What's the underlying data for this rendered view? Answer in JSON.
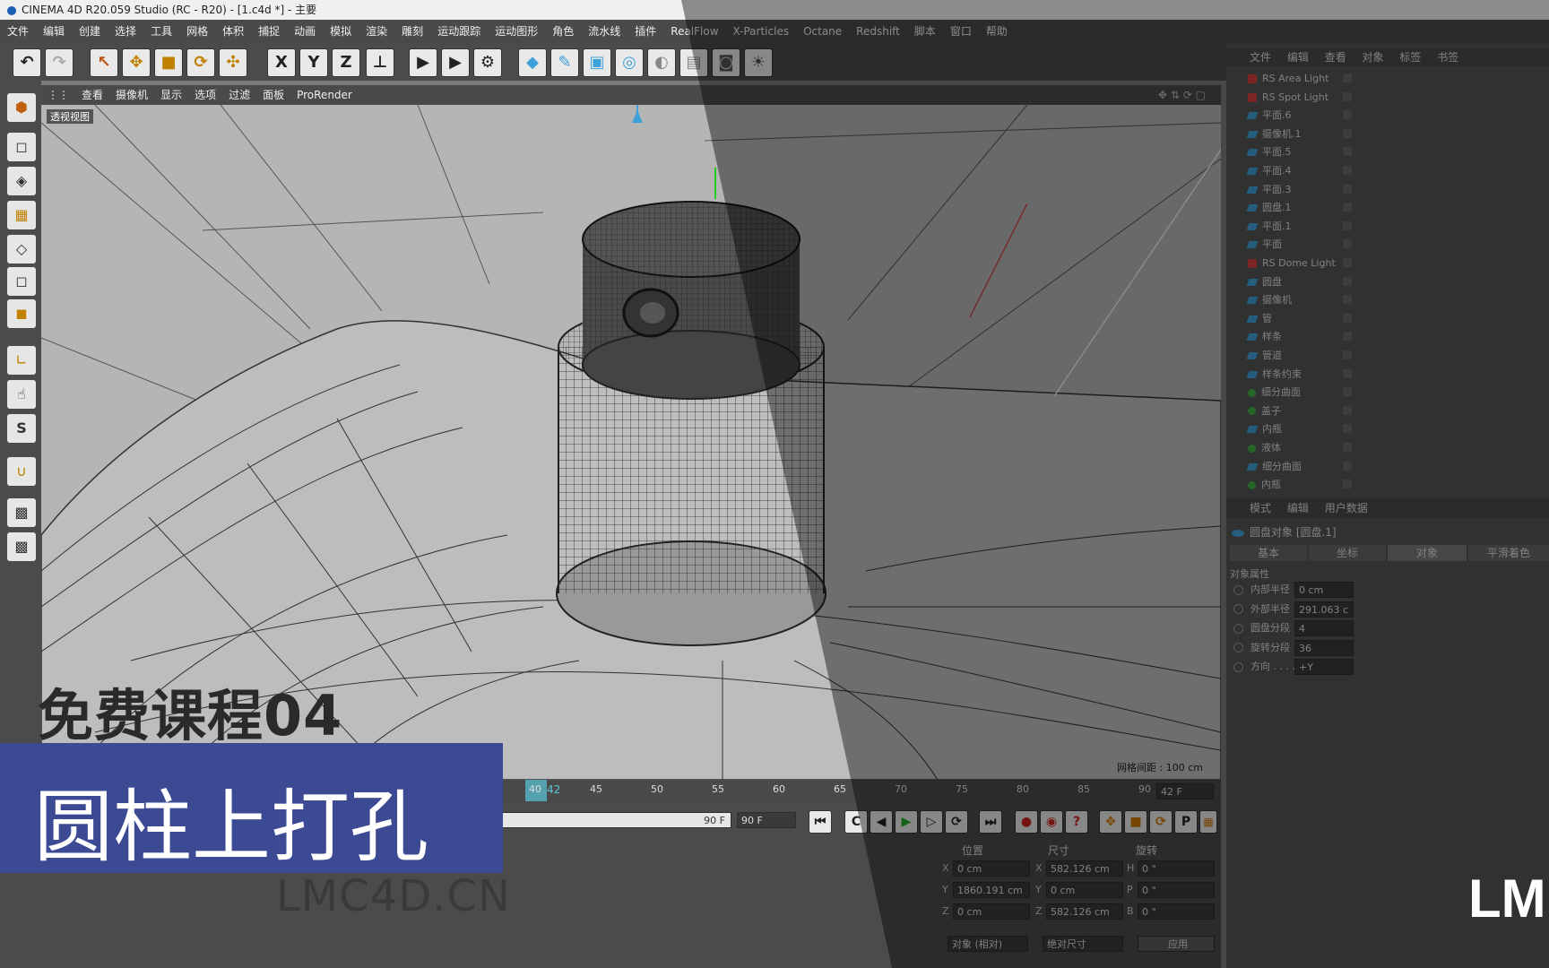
{
  "window": {
    "title": "CINEMA 4D R20.059 Studio (RC - R20) - [1.c4d *] - 主要"
  },
  "menu": [
    "文件",
    "编辑",
    "创建",
    "选择",
    "工具",
    "网格",
    "体积",
    "捕捉",
    "动画",
    "模拟",
    "渲染",
    "雕刻",
    "运动跟踪",
    "运动图形",
    "角色",
    "流水线",
    "插件",
    "RealFlow",
    "X-Particles",
    "Octane",
    "Redshift",
    "脚本",
    "窗口",
    "帮助"
  ],
  "toolbar_icons": [
    "undo-icon",
    "redo-icon",
    "select-arrow-icon",
    "move-icon",
    "scale-icon",
    "rotate-icon",
    "transform-icon",
    "x-axis-icon",
    "y-axis-icon",
    "z-axis-icon",
    "coordinate-system-icon",
    "render-view-icon",
    "render-picture-viewer-icon",
    "render-settings-icon",
    "cube-icon",
    "pen-icon",
    "subdivision-icon",
    "array-icon",
    "deformer-icon",
    "floor-icon",
    "camera-icon",
    "light-icon"
  ],
  "toolbar_axis_labels": [
    "X",
    "Y",
    "Z"
  ],
  "viewport_menu": [
    "查看",
    "摄像机",
    "显示",
    "选项",
    "过滤",
    "面板",
    "ProRender"
  ],
  "viewport_label": "透视视图",
  "grid_spacing": "网格间距 : 100 cm",
  "objects": [
    {
      "name": "RS Area Light",
      "icon": "red"
    },
    {
      "name": "RS Spot Light",
      "icon": "red"
    },
    {
      "name": "平面.6",
      "icon": "blue"
    },
    {
      "name": "摄像机.1",
      "icon": "blue"
    },
    {
      "name": "平面.5",
      "icon": "blue"
    },
    {
      "name": "平面.4",
      "icon": "blue"
    },
    {
      "name": "平面.3",
      "icon": "blue"
    },
    {
      "name": "圆盘.1",
      "icon": "blue"
    },
    {
      "name": "平面.1",
      "icon": "blue"
    },
    {
      "name": "平面",
      "icon": "blue"
    },
    {
      "name": "RS Dome Light",
      "icon": "red"
    },
    {
      "name": "圆盘",
      "icon": "blue"
    },
    {
      "name": "摄像机",
      "icon": "blue"
    },
    {
      "name": "管",
      "icon": "blue"
    },
    {
      "name": "样条",
      "icon": "blue"
    },
    {
      "name": "管道",
      "icon": "blue"
    },
    {
      "name": "样条约束",
      "icon": "blue"
    },
    {
      "name": "细分曲面",
      "icon": "green"
    },
    {
      "name": "盖子",
      "icon": "green"
    },
    {
      "name": "内瓶",
      "icon": "blue"
    },
    {
      "name": "液体",
      "icon": "green"
    },
    {
      "name": "细分曲面",
      "icon": "blue"
    },
    {
      "name": "内瓶",
      "icon": "green"
    }
  ],
  "om_tabs": [
    "文件",
    "编辑",
    "查看",
    "对象",
    "标签",
    "书签"
  ],
  "attr_tabs_header": [
    "模式",
    "编辑",
    "用户数据"
  ],
  "attr_object_title": "圆盘对象 [圆盘.1]",
  "attr_subtabs": [
    "基本",
    "坐标",
    "对象",
    "平滑着色(Phong)"
  ],
  "attr_section": "对象属性",
  "attr_rows": [
    {
      "label": "内部半径",
      "value": "0 cm"
    },
    {
      "label": "外部半径",
      "value": "291.063 c"
    },
    {
      "label": "圆盘分段",
      "value": "4"
    },
    {
      "label": "旋转分段",
      "value": "36"
    },
    {
      "label": "方向 . . . .",
      "value": "+Y"
    }
  ],
  "timeline": {
    "ticks": [
      "40",
      "45",
      "50",
      "55",
      "60",
      "65",
      "70",
      "75",
      "80",
      "85",
      "90"
    ],
    "current_frame": "42",
    "frame_field": "42 F",
    "end_field_a": "90 F",
    "end_field_b": "90 F"
  },
  "coords": {
    "headers": [
      "位置",
      "尺寸",
      "旋转"
    ],
    "rows": [
      {
        "axis": "X",
        "pos": "0 cm",
        "size_axis": "X",
        "size": "582.126 cm",
        "rot_axis": "H",
        "rot": "0 °"
      },
      {
        "axis": "Y",
        "pos": "1860.191 cm",
        "size_axis": "Y",
        "size": "0 cm",
        "rot_axis": "P",
        "rot": "0 °"
      },
      {
        "axis": "Z",
        "pos": "0 cm",
        "size_axis": "Z",
        "size": "582.126 cm",
        "rot_axis": "B",
        "rot": "0 °"
      }
    ],
    "mode_select": "对象 (相对)",
    "size_select": "绝对尺寸",
    "apply_button": "应用"
  },
  "overlay": {
    "course_tag": "免费课程04",
    "banner_title": "圆柱上打孔",
    "site": "LMC4D.CN",
    "logo_text": "LM"
  },
  "colors": {
    "banner": "#3c4a94",
    "viewport_bg": "#b5b5b5",
    "ui_dark": "#4b4b4b"
  }
}
